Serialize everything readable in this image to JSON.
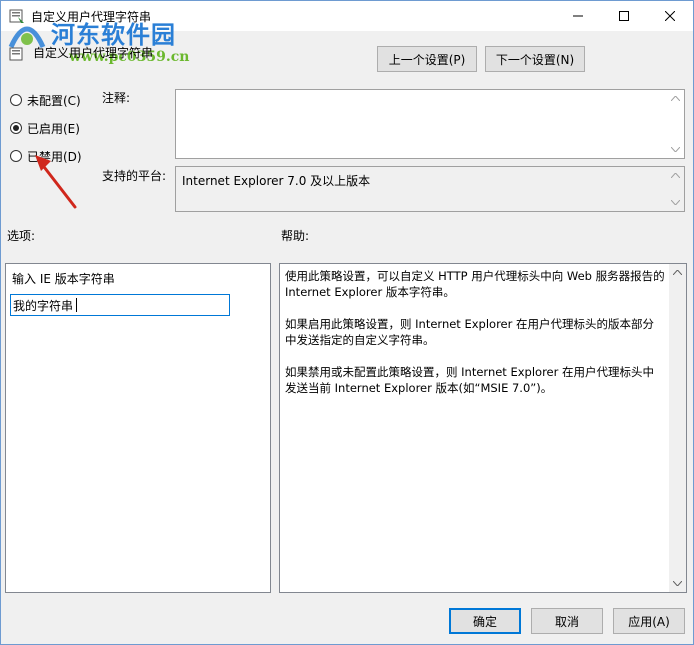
{
  "window": {
    "title": "自定义用户代理字符串",
    "controls": {
      "minimize": "minimize-icon",
      "maximize": "maximize-icon",
      "close": "close-icon"
    }
  },
  "watermark": {
    "name": "河东软件园",
    "url": "www.pc0359.cn"
  },
  "policy": {
    "name": "自定义用户代理字符串"
  },
  "nav": {
    "prev": "上一个设置(P)",
    "next": "下一个设置(N)"
  },
  "state": {
    "options": [
      {
        "label": "未配置(C)",
        "selected": false
      },
      {
        "label": "已启用(E)",
        "selected": true
      },
      {
        "label": "已禁用(D)",
        "selected": false
      }
    ]
  },
  "comment": {
    "label": "注释:",
    "value": ""
  },
  "platform": {
    "label": "支持的平台:",
    "value": "Internet Explorer 7.0 及以上版本"
  },
  "options_section": {
    "label": "选项:",
    "field_label": "输入 IE 版本字符串",
    "field_value": "我的字符串"
  },
  "help": {
    "label": "帮助:",
    "paragraphs": [
      "使用此策略设置，可以自定义 HTTP 用户代理标头中向 Web 服务器报告的 Internet Explorer 版本字符串。",
      "如果启用此策略设置，则 Internet Explorer 在用户代理标头的版本部分中发送指定的自定义字符串。",
      "如果禁用或未配置此策略设置，则 Internet Explorer 在用户代理标头中发送当前 Internet Explorer 版本(如“MSIE 7.0”)。"
    ]
  },
  "footer": {
    "ok": "确定",
    "cancel": "取消",
    "apply": "应用(A)"
  },
  "colors": {
    "accent": "#0078d7",
    "annotation_arrow": "#d0271c",
    "watermark_blue": "#2a7fd6",
    "watermark_green": "#6bb82e"
  }
}
